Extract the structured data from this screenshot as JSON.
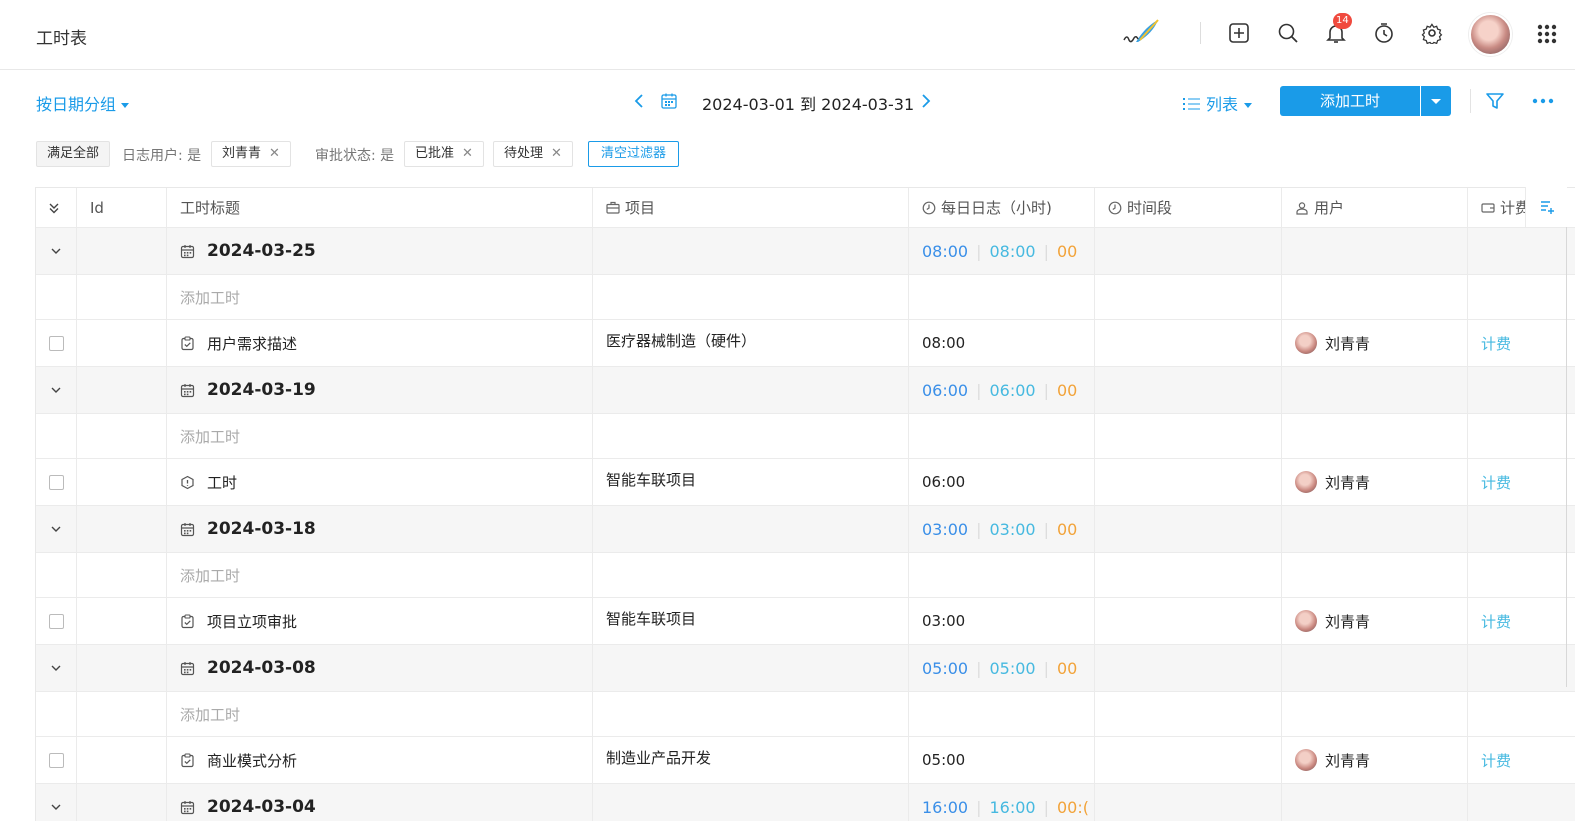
{
  "header": {
    "title": "工时表",
    "notification_count": "14",
    "icons": [
      "logo-quill-icon",
      "plus-square-icon",
      "search-icon",
      "bell-icon",
      "timer-icon",
      "gear-icon",
      "avatar",
      "apps-grid-icon"
    ]
  },
  "toolbar": {
    "group_by_label": "按日期分组",
    "date_range": "2024-03-01 到 2024-03-31",
    "view_label": "列表",
    "add_label": "添加工时"
  },
  "filters": {
    "match_label": "满足全部",
    "user_filter_label": "日志用户: 是",
    "user_value": "刘青青",
    "status_filter_label": "审批状态: 是",
    "status_values": [
      "已批准",
      "待处理"
    ],
    "clear_label": "清空过滤器"
  },
  "table": {
    "columns": {
      "id": "Id",
      "title": "工时标题",
      "project": "项目",
      "daily_log": "每日日志（小时)",
      "period": "时间段",
      "user": "用户",
      "billing": "计费"
    },
    "add_row_label": "添加工时",
    "groups": [
      {
        "date": "2024-03-25",
        "t1": "08:00",
        "t2": "08:00",
        "t3": "00",
        "item": {
          "title": "用户需求描述",
          "project": "医疗器械制造（硬件）",
          "hours": "08:00",
          "user": "刘青青",
          "billing": "计费"
        }
      },
      {
        "date": "2024-03-19",
        "t1": "06:00",
        "t2": "06:00",
        "t3": "00",
        "item": {
          "title": "工时",
          "project": "智能车联项目",
          "hours": "06:00",
          "user": "刘青青",
          "billing": "计费"
        }
      },
      {
        "date": "2024-03-18",
        "t1": "03:00",
        "t2": "03:00",
        "t3": "00",
        "item": {
          "title": "项目立项审批",
          "project": "智能车联项目",
          "hours": "03:00",
          "user": "刘青青",
          "billing": "计费"
        }
      },
      {
        "date": "2024-03-08",
        "t1": "05:00",
        "t2": "05:00",
        "t3": "00",
        "item": {
          "title": "商业模式分析",
          "project": "制造业产品开发",
          "hours": "05:00",
          "user": "刘青青",
          "billing": "计费"
        }
      },
      {
        "date": "2024-03-04",
        "t1": "16:00",
        "t2": "16:00",
        "t3": "00:("
      }
    ]
  },
  "colors": {
    "accent": "#1a9be8",
    "blue": "#3a8fe8",
    "cyan": "#46b9e0",
    "orange": "#f2a33a",
    "badge": "#f04a3e"
  }
}
